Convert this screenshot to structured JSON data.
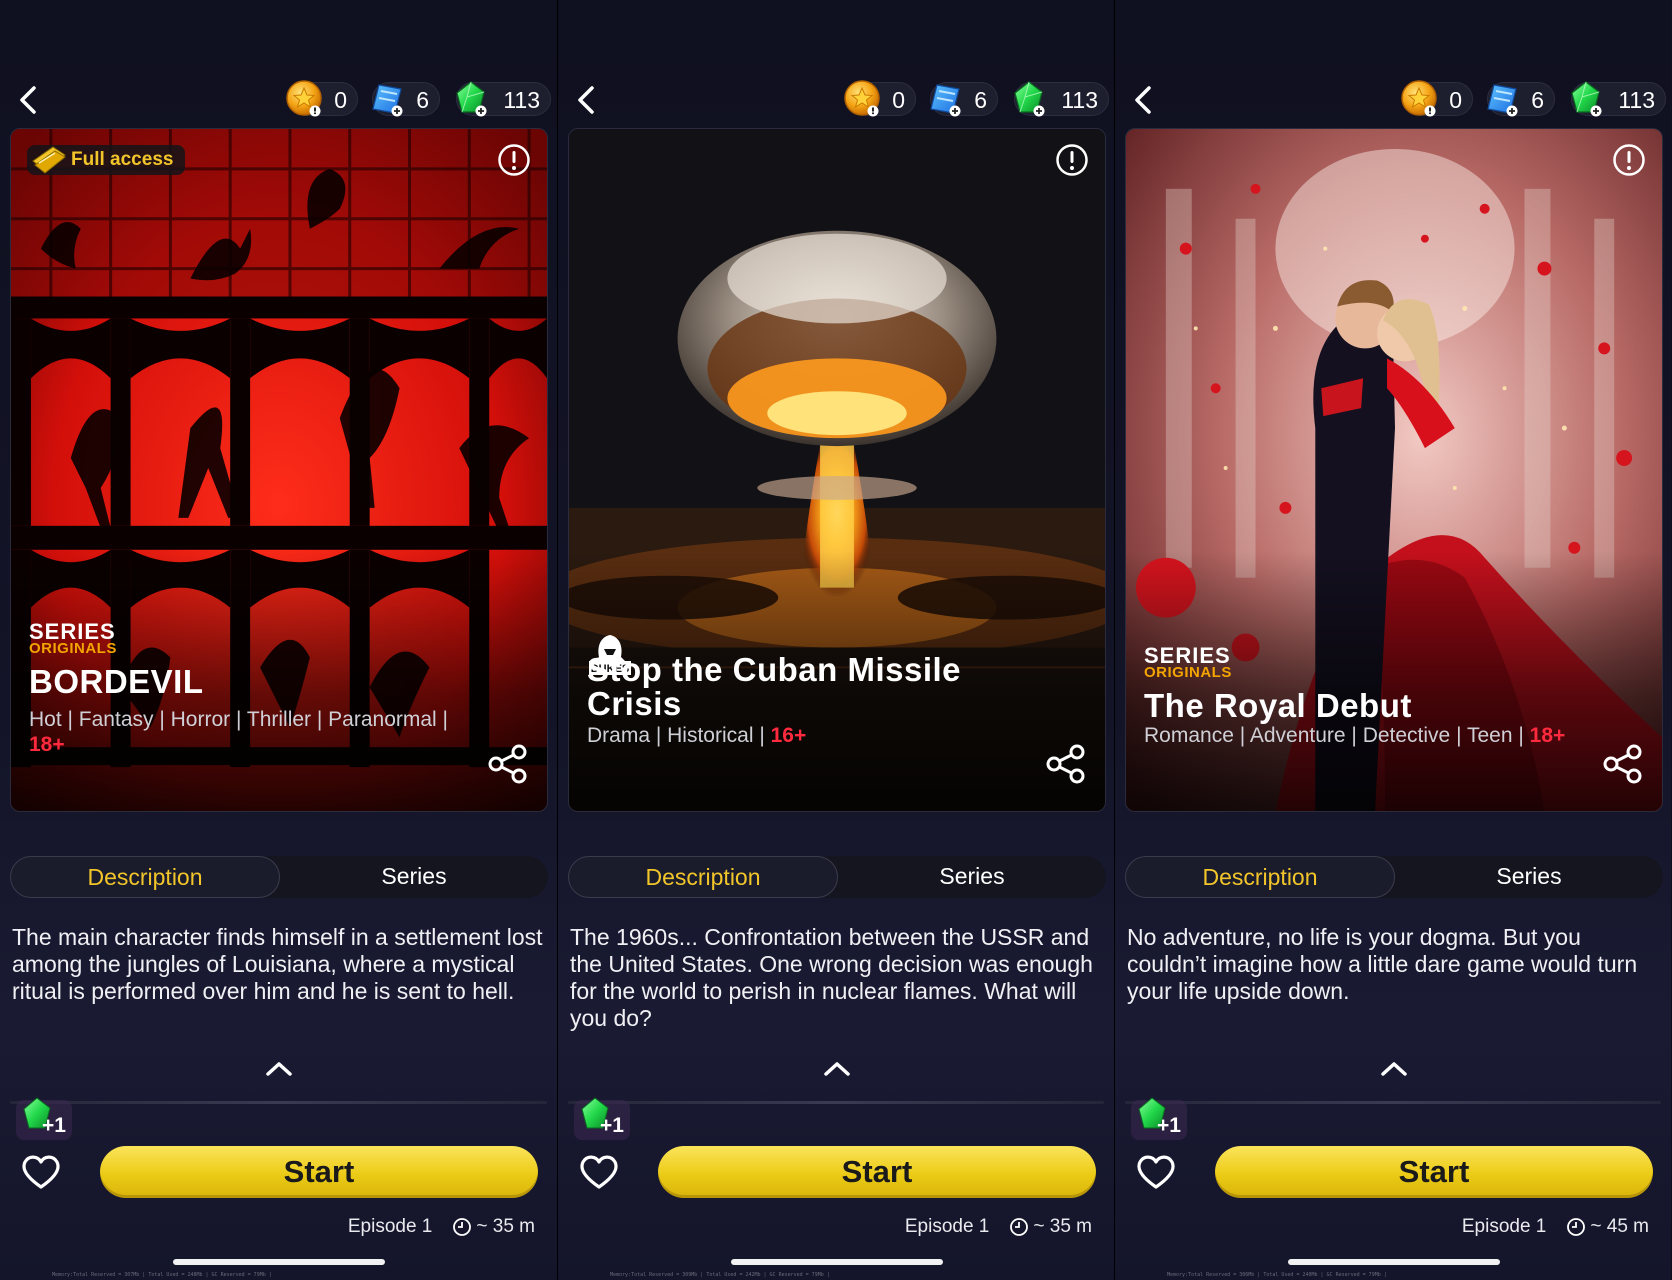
{
  "colors": {
    "accent": "#f2c52a",
    "age_rating": "#ff2a3d",
    "start_button": "#eccb16"
  },
  "icons": {
    "back": "chevron-left-icon",
    "coin": "coin-icon",
    "ticket": "ticket-icon",
    "gem": "gem-icon",
    "warning": "info-alert-icon",
    "share": "share-icon",
    "heart": "heart-icon",
    "clock": "clock-icon",
    "expand": "chevron-up-icon"
  },
  "panels": [
    {
      "currency": {
        "coins": "0",
        "tickets": "6",
        "gems": "113"
      },
      "badge": "Full access",
      "brand": {
        "line1": "SERIES",
        "line2": "ORIGINALS"
      },
      "title": "BORDEVIL",
      "genres": "Hot | Fantasy | Horror | Thriller | Paranormal |",
      "age": "18+",
      "tabs": {
        "description": "Description",
        "series": "Series"
      },
      "description": "The main character finds himself in a settlement lost among the jungles of Louisiana, where a mystical ritual is performed over him and he is sent to hell.",
      "reward": "+1",
      "start": "Start",
      "episode": "Episode 1",
      "duration": "~ 35 m",
      "memory": "Memory:Total Reserved = 307Mb | Total Used = 248Mb | GC Reserved = 79Mb |"
    },
    {
      "currency": {
        "coins": "0",
        "tickets": "6",
        "gems": "113"
      },
      "studio": "DUKES",
      "title": "Stop the Cuban Missile Crisis",
      "genres": "Drama | Historical |",
      "age": "16+",
      "tabs": {
        "description": "Description",
        "series": "Series"
      },
      "description": "The 1960s... Confrontation between the USSR and the United States. One wrong decision was enough for the world to perish in nuclear flames. What will you do?",
      "reward": "+1",
      "start": "Start",
      "episode": "Episode 1",
      "duration": "~ 35 m",
      "memory": "Memory:Total Reserved = 309Mb | Total Used = 242Mb | GC Reserved = 79Mb |"
    },
    {
      "currency": {
        "coins": "0",
        "tickets": "6",
        "gems": "113"
      },
      "brand": {
        "line1": "SERIES",
        "line2": "ORIGINALS"
      },
      "title": "The Royal Debut",
      "genres": "Romance | Adventure | Detective | Teen |",
      "age": "18+",
      "tabs": {
        "description": "Description",
        "series": "Series"
      },
      "description": "No adventure, no life is your dogma. But you couldn’t imagine how a little dare game would turn your life upside down.",
      "reward": "+1",
      "start": "Start",
      "episode": "Episode 1",
      "duration": "~ 45 m",
      "memory": "Memory:Total Reserved = 306Mb | Total Used = 240Mb | GC Reserved = 79Mb |"
    }
  ]
}
